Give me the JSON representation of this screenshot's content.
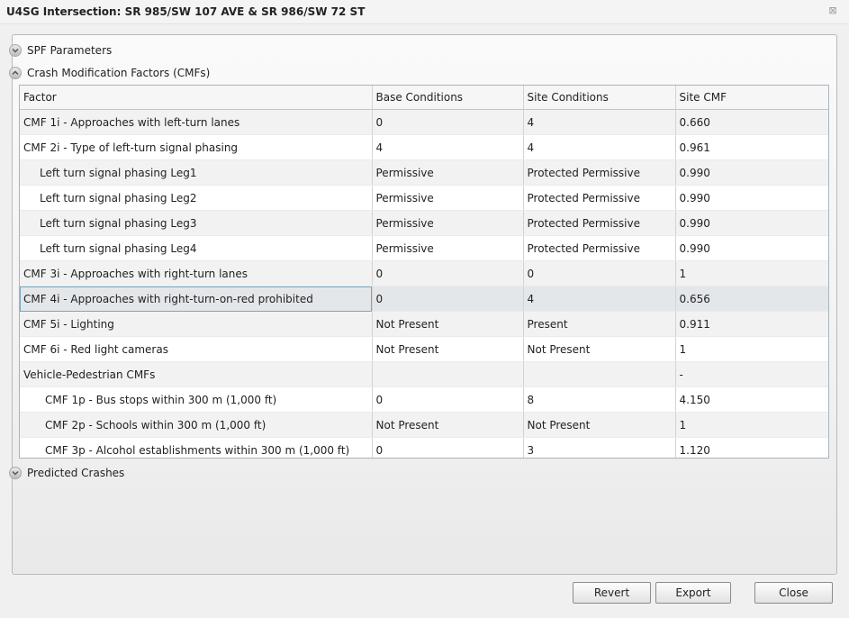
{
  "window": {
    "title": "U4SG Intersection: SR 985/SW 107 AVE & SR 986/SW 72 ST",
    "close_glyph": "⊠"
  },
  "sections": {
    "spf": {
      "label": "SPF Parameters",
      "expanded": false
    },
    "cmf": {
      "label": "Crash Modification Factors (CMFs)",
      "expanded": true
    },
    "predicted": {
      "label": "Predicted Crashes",
      "expanded": false
    }
  },
  "table": {
    "columns": [
      "Factor",
      "Base Conditions",
      "Site Conditions",
      "Site CMF"
    ],
    "rows": [
      {
        "factor": "CMF 1i - Approaches with left-turn lanes",
        "base": "0",
        "site": "4",
        "cmf": "0.660",
        "indent": 0
      },
      {
        "factor": "CMF 2i - Type of left-turn signal phasing",
        "base": "4",
        "site": "4",
        "cmf": "0.961",
        "indent": 0
      },
      {
        "factor": "Left turn signal phasing Leg1",
        "base": "Permissive",
        "site": "Protected Permissive",
        "cmf": "0.990",
        "indent": 1
      },
      {
        "factor": "Left turn signal phasing Leg2",
        "base": "Permissive",
        "site": "Protected Permissive",
        "cmf": "0.990",
        "indent": 1
      },
      {
        "factor": "Left turn signal phasing Leg3",
        "base": "Permissive",
        "site": "Protected Permissive",
        "cmf": "0.990",
        "indent": 1
      },
      {
        "factor": "Left turn signal phasing Leg4",
        "base": "Permissive",
        "site": "Protected Permissive",
        "cmf": "0.990",
        "indent": 1
      },
      {
        "factor": "CMF 3i - Approaches with right-turn lanes",
        "base": "0",
        "site": "0",
        "cmf": "1",
        "indent": 0
      },
      {
        "factor": "CMF 4i - Approaches with right-turn-on-red prohibited",
        "base": "0",
        "site": "4",
        "cmf": "0.656",
        "indent": 0,
        "selected": true
      },
      {
        "factor": "CMF 5i - Lighting",
        "base": "Not Present",
        "site": "Present",
        "cmf": "0.911",
        "indent": 0
      },
      {
        "factor": "CMF 6i - Red light cameras",
        "base": "Not Present",
        "site": "Not Present",
        "cmf": "1",
        "indent": 0
      },
      {
        "factor": "Vehicle-Pedestrian CMFs",
        "base": "",
        "site": "",
        "cmf": "-",
        "indent": 0
      },
      {
        "factor": "CMF 1p - Bus stops within 300 m (1,000 ft)",
        "base": "0",
        "site": "8",
        "cmf": "4.150",
        "indent": 2
      },
      {
        "factor": "CMF 2p - Schools within 300 m (1,000 ft)",
        "base": "Not Present",
        "site": "Not Present",
        "cmf": "1",
        "indent": 2
      },
      {
        "factor": "CMF 3p - Alcohol establishments within 300 m (1,000 ft)",
        "base": "0",
        "site": "3",
        "cmf": "1.120",
        "indent": 2
      }
    ]
  },
  "buttons": {
    "revert": "Revert",
    "export": "Export",
    "close": "Close"
  },
  "colors": {
    "selected_row": "#e4e7ea",
    "stripe_row": "#f2f2f2",
    "focus_outline": "#7aa6c2"
  }
}
